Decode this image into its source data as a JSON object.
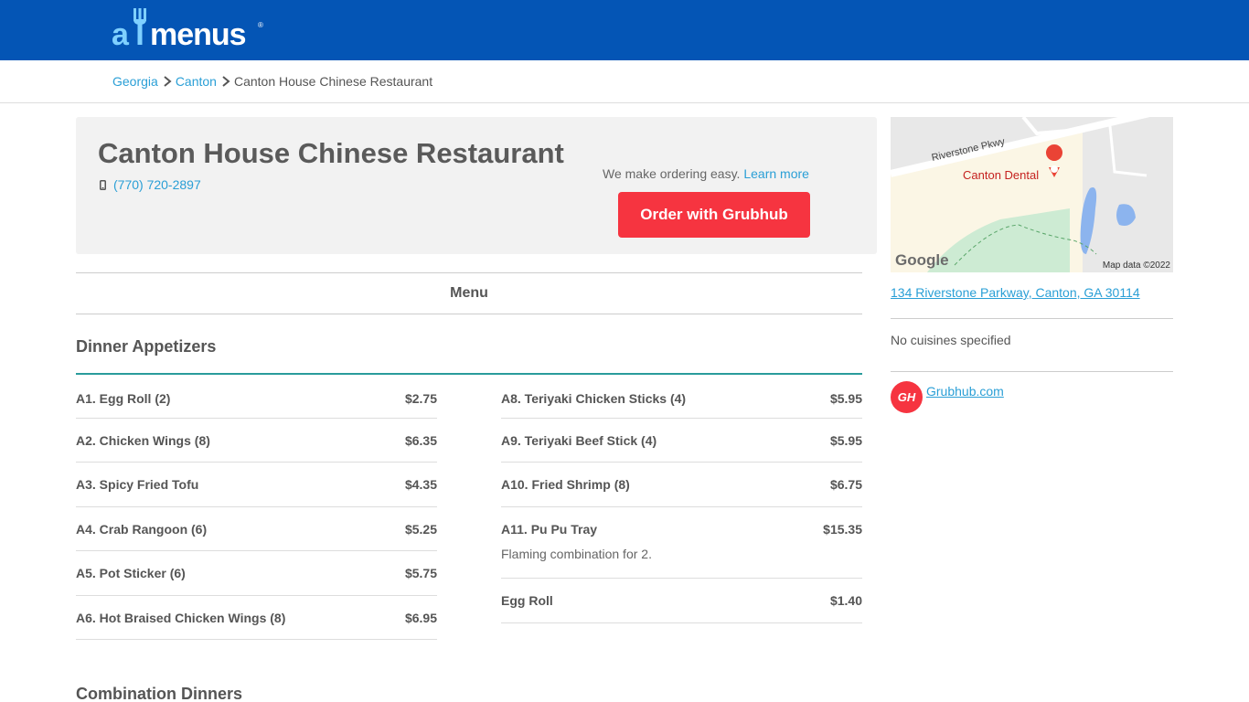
{
  "brand": {
    "logo_a": "a",
    "logo_menus": "menus",
    "registered": "®"
  },
  "breadcrumb": {
    "items": [
      {
        "label": "Georgia"
      },
      {
        "label": "Canton"
      }
    ],
    "current": "Canton House Chinese Restaurant"
  },
  "restaurant": {
    "name": "Canton House Chinese Restaurant",
    "phone": "(770) 720-2897",
    "ordering_text": "We make ordering easy.",
    "learn_more": "Learn more",
    "order_button": "Order with Grubhub"
  },
  "menu_tab": "Menu",
  "sections": [
    {
      "title": "Dinner Appetizers",
      "left": [
        {
          "name": "A1. Egg Roll (2)",
          "price": "$2.75"
        },
        {
          "name": "A2. Chicken Wings (8)",
          "price": "$6.35"
        },
        {
          "name": "A3. Spicy Fried Tofu",
          "price": "$4.35"
        },
        {
          "name": "A4. Crab Rangoon (6)",
          "price": "$5.25"
        },
        {
          "name": "A5. Pot Sticker (6)",
          "price": "$5.75"
        },
        {
          "name": "A6. Hot Braised Chicken Wings (8)",
          "price": "$6.95"
        }
      ],
      "right": [
        {
          "name": "A8. Teriyaki Chicken Sticks (4)",
          "price": "$5.95"
        },
        {
          "name": "A9. Teriyaki Beef Stick (4)",
          "price": "$5.95"
        },
        {
          "name": "A10. Fried Shrimp (8)",
          "price": "$6.75"
        },
        {
          "name": "A11. Pu Pu Tray",
          "price": "$15.35",
          "desc": "Flaming combination for 2."
        },
        {
          "name": "Egg Roll",
          "price": "$1.40"
        }
      ]
    },
    {
      "title": "Combination Dinners"
    }
  ],
  "map": {
    "road": "Riverstone Pkwy",
    "poi": "Canton Dental",
    "google": "Google",
    "credit": "Map data ©2022",
    "colors": {
      "land": "#fbf6e5",
      "park": "#cdebd3",
      "water": "#8cb4ee",
      "poi": "#ea4335"
    }
  },
  "sidebar": {
    "address": "134 Riverstone Parkway, Canton, GA 30114",
    "cuisines": "No cuisines specified",
    "grubhub_badge": "GH",
    "grubhub_link": "Grubhub.com"
  },
  "colors": {
    "topbar": "#0455b5",
    "link": "#2a9fd6",
    "order_button": "#f63440",
    "section_rule": "#2a9c9c"
  }
}
